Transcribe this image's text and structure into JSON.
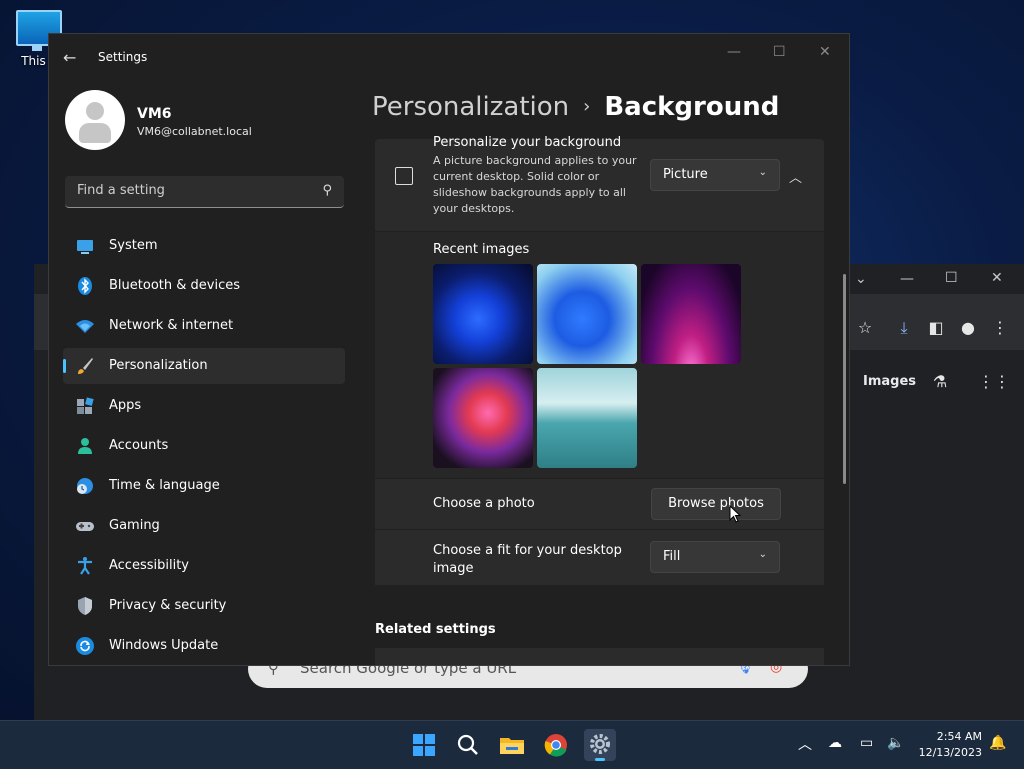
{
  "desktop": {
    "icon_label": "This P"
  },
  "browser": {
    "images_link": "Images",
    "search_placeholder": "Search Google or type a URL"
  },
  "settings": {
    "window_title": "Settings",
    "user": {
      "name": "VM6",
      "email": "VM6@collabnet.local"
    },
    "find_placeholder": "Find a setting",
    "nav": [
      {
        "label": "System",
        "icon": "system-icon"
      },
      {
        "label": "Bluetooth & devices",
        "icon": "bluetooth-icon"
      },
      {
        "label": "Network & internet",
        "icon": "wifi-icon"
      },
      {
        "label": "Personalization",
        "icon": "paintbrush-icon",
        "active": true
      },
      {
        "label": "Apps",
        "icon": "apps-icon"
      },
      {
        "label": "Accounts",
        "icon": "accounts-icon"
      },
      {
        "label": "Time & language",
        "icon": "globe-clock-icon"
      },
      {
        "label": "Gaming",
        "icon": "gamepad-icon"
      },
      {
        "label": "Accessibility",
        "icon": "accessibility-icon"
      },
      {
        "label": "Privacy & security",
        "icon": "shield-icon"
      },
      {
        "label": "Windows Update",
        "icon": "update-icon"
      }
    ],
    "breadcrumb": {
      "parent": "Personalization",
      "separator": "›",
      "current": "Background"
    },
    "background_card": {
      "heading": "Personalize your background",
      "description": "A picture background applies to your current desktop. Solid color or slideshow backgrounds apply to all your desktops.",
      "selected": "Picture"
    },
    "recent_images_label": "Recent images",
    "choose_photo": {
      "label": "Choose a photo",
      "button": "Browse photos"
    },
    "fit": {
      "label": "Choose a fit for your desktop image",
      "selected": "Fill"
    },
    "related_settings": "Related settings"
  },
  "taskbar": {
    "apps": [
      "start-icon",
      "search-icon",
      "file-explorer-icon",
      "chrome-icon",
      "settings-icon"
    ],
    "time": "2:54 AM",
    "date": "12/13/2023"
  },
  "colors": {
    "accent": "#4cc2ff",
    "window_bg": "#202020",
    "card_bg": "#2b2b2b"
  }
}
